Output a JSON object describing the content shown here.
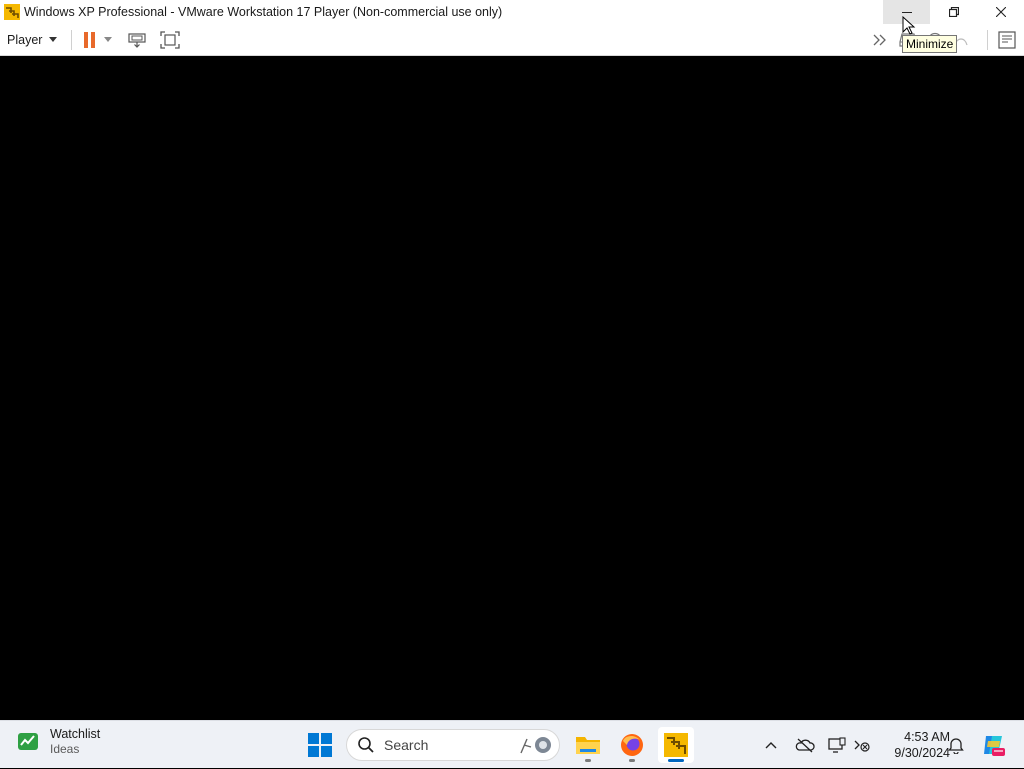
{
  "window": {
    "title": "Windows XP Professional - VMware Workstation 17 Player (Non-commercial use only)",
    "tooltip": "Minimize"
  },
  "toolbar": {
    "player_menu_label": "Player",
    "icons": [
      "pause-icon",
      "send-ctrl-alt-del-icon",
      "fullscreen-icon",
      "more-icon",
      "removable-device-icon",
      "cd-dvd-icon",
      "usb-icon",
      "message-log-icon"
    ]
  },
  "colors": {
    "pause_accent": "#e8692a",
    "taskbar_bg": "#eef1f6",
    "vm_screen": "#000000",
    "start_blue": "#0078d4"
  },
  "taskbar": {
    "widget": {
      "title": "Watchlist",
      "subtitle": "Ideas"
    },
    "search_placeholder": "Search",
    "apps": [
      "file-explorer-icon",
      "firefox-icon",
      "vmware-player-icon"
    ],
    "clock": {
      "time": "4:53 AM",
      "date": "9/30/2024"
    }
  }
}
